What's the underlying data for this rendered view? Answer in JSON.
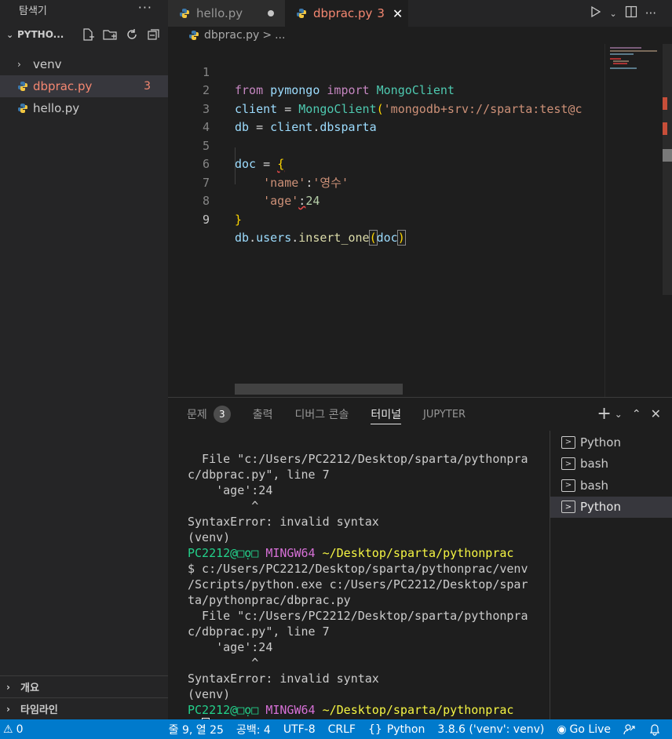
{
  "explorer": {
    "title": "탐색기",
    "more": "···",
    "folder": "PYTHO...",
    "items": [
      {
        "label": "venv",
        "type": "folder"
      },
      {
        "label": "dbprac.py",
        "badge": "3",
        "active": true
      },
      {
        "label": "hello.py"
      }
    ],
    "outline": "개요",
    "timeline": "타임라인"
  },
  "tabs": [
    {
      "label": "hello.py"
    },
    {
      "label": "dbprac.py",
      "count": "3"
    }
  ],
  "breadcrumb": {
    "file": "dbprac.py",
    "sep": ">",
    "more": "..."
  },
  "editor": {
    "line_numbers": [
      "1",
      "2",
      "3",
      "4",
      "5",
      "6",
      "7",
      "8",
      "9"
    ],
    "lines": {
      "l1": [
        "from",
        " ",
        "pymongo",
        " ",
        "import",
        " ",
        "MongoClient"
      ],
      "l2": [
        "client",
        " = ",
        "MongoClient",
        "(",
        "'mongodb+srv://sparta:test@c"
      ],
      "l3": [
        "db",
        " = ",
        "client",
        ".",
        "dbsparta"
      ],
      "l5": [
        "doc",
        " = ",
        "{"
      ],
      "l6": [
        "    ",
        "'name'",
        ":",
        "'영수'"
      ],
      "l7": [
        "    ",
        "'age'",
        ":",
        "24"
      ],
      "l8": [
        "}"
      ],
      "l9": [
        "db",
        ".",
        "users",
        ".",
        "insert_one",
        "(",
        "doc",
        ")"
      ]
    }
  },
  "panel": {
    "tabs": [
      "문제",
      "출력",
      "디버그 콘솔",
      "터미널",
      "JUPYTER"
    ],
    "problems_count": "3",
    "terminal_lines": [
      {
        "t": "  File \"c:/Users/PC2212/Desktop/sparta/pythonpra"
      },
      {
        "t": "c/dbprac.py\", line 7"
      },
      {
        "t": "    'age':24"
      },
      {
        "t": "         ^"
      },
      {
        "t": "SyntaxError: invalid syntax"
      },
      {
        "t": "(venv)"
      },
      {
        "prompt": [
          "PC2212@□ọ□",
          " MINGW64",
          " ~/Desktop/sparta/pythonprac"
        ]
      },
      {
        "t": "$ c:/Users/PC2212/Desktop/sparta/pythonprac/venv"
      },
      {
        "t": "/Scripts/python.exe c:/Users/PC2212/Desktop/spar"
      },
      {
        "t": "ta/pythonprac/dbprac.py"
      },
      {
        "t": "  File \"c:/Users/PC2212/Desktop/sparta/pythonpra"
      },
      {
        "t": "c/dbprac.py\", line 7"
      },
      {
        "t": "    'age':24"
      },
      {
        "t": "         ^"
      },
      {
        "t": "SyntaxError: invalid syntax"
      },
      {
        "t": "(venv)"
      },
      {
        "prompt": [
          "PC2212@□ọ□",
          " MINGW64",
          " ~/Desktop/sparta/pythonprac"
        ]
      },
      {
        "input": "$ "
      }
    ],
    "terminals": [
      "Python",
      "bash",
      "bash",
      "Python"
    ]
  },
  "status": {
    "warnings": "0",
    "position": "줄 9, 열 25",
    "spaces": "공백: 4",
    "encoding": "UTF-8",
    "eol": "CRLF",
    "language": "Python",
    "interpreter": "3.8.6 ('venv': venv)",
    "golive": "Go Live"
  }
}
